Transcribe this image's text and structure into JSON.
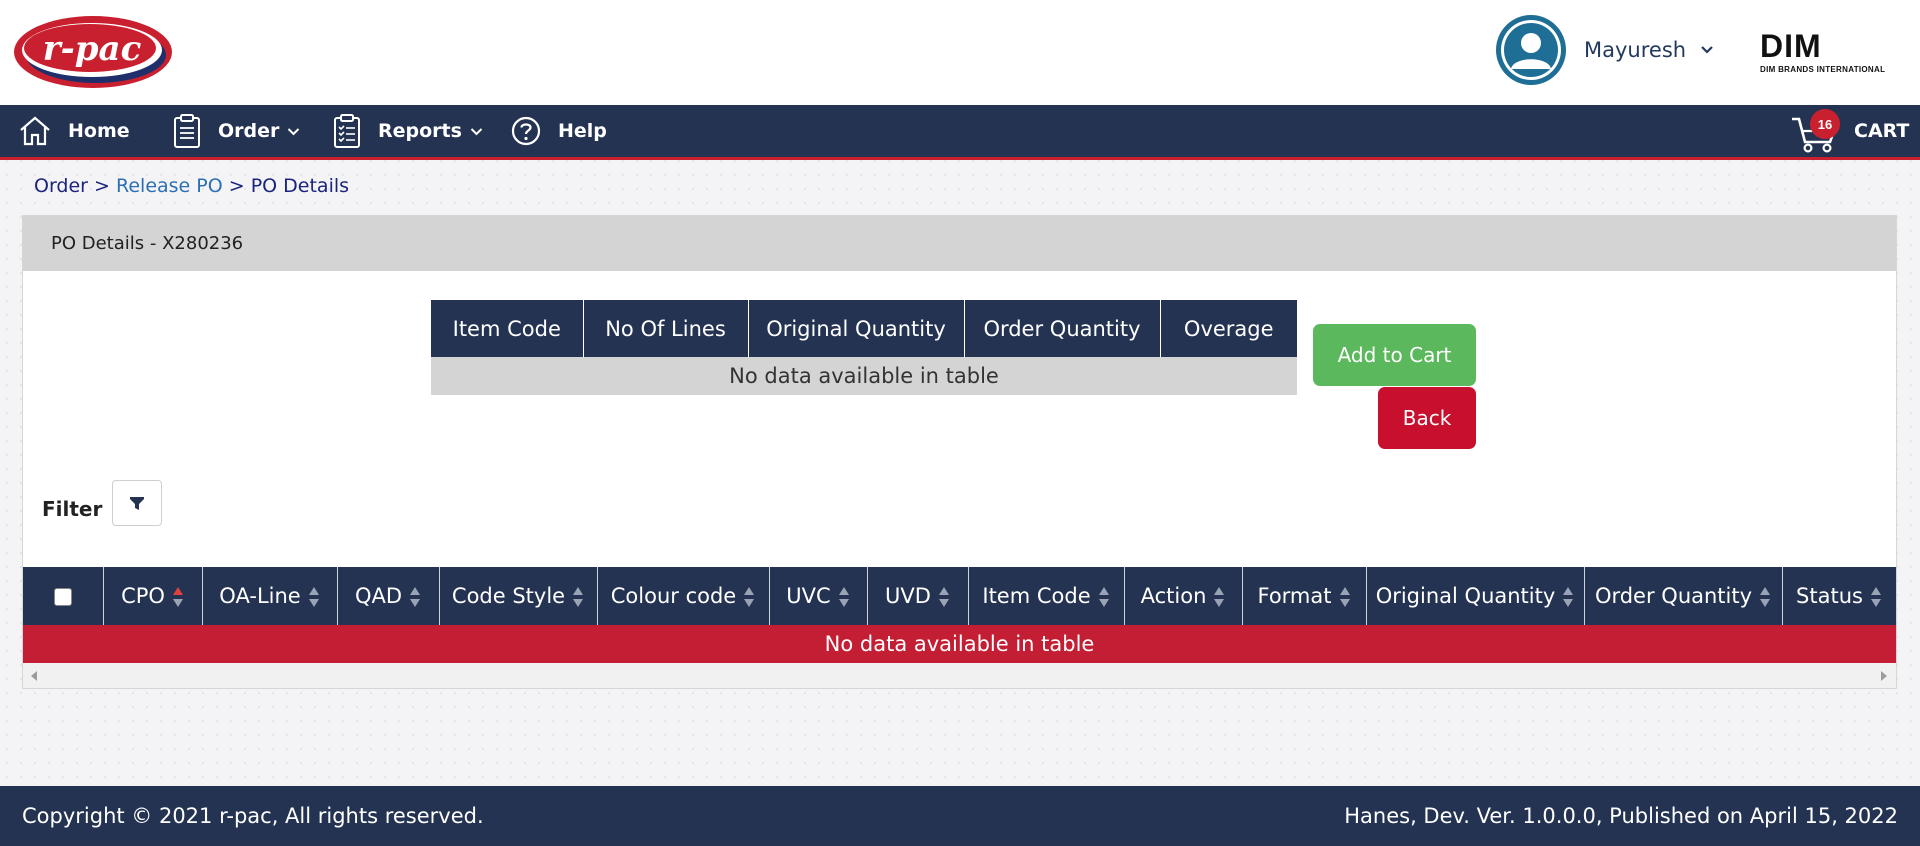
{
  "header": {
    "brand_logo_text": "r-pac",
    "user_name": "Mayuresh",
    "partner_logo_main": "DIM",
    "partner_logo_sub": "DIM BRANDS INTERNATIONAL"
  },
  "nav": {
    "items": [
      {
        "label": "Home",
        "icon": "home-icon"
      },
      {
        "label": "Order",
        "icon": "clipboard-icon",
        "dropdown": true
      },
      {
        "label": "Reports",
        "icon": "clipboard-list-icon",
        "dropdown": true
      },
      {
        "label": "Help",
        "icon": "help-circle-icon"
      }
    ],
    "cart_label": "CART",
    "cart_count": "16"
  },
  "breadcrumb": {
    "part1": "Order",
    "sep1": " > ",
    "part2": "Release PO",
    "sep2": " > ",
    "part3": "PO Details"
  },
  "card": {
    "title": "PO Details - X280236"
  },
  "summary_table": {
    "columns": [
      "Item Code",
      "No Of Lines",
      "Original Quantity",
      "Order Quantity",
      "Overage"
    ],
    "empty_text": "No data available in table"
  },
  "buttons": {
    "add_to_cart": "Add to Cart",
    "back": "Back"
  },
  "filter": {
    "label": "Filter"
  },
  "detail_table": {
    "columns": [
      "CPO",
      "OA-Line",
      "QAD",
      "Code Style",
      "Colour code",
      "UVC",
      "UVD",
      "Item Code",
      "Action",
      "Format",
      "Original Quantity",
      "Order Quantity",
      "Status"
    ],
    "sorted_column": "CPO",
    "empty_text": "No data available in table"
  },
  "footer": {
    "copyright": "Copyright © 2021 r-pac, All rights reserved.",
    "version": "Hanes, Dev. Ver. 1.0.0.0, Published on April 15, 2022"
  },
  "colors": {
    "navy": "#243352",
    "red": "#c8202f",
    "green": "#5cb85c",
    "gray_header": "#d4d4d4"
  }
}
